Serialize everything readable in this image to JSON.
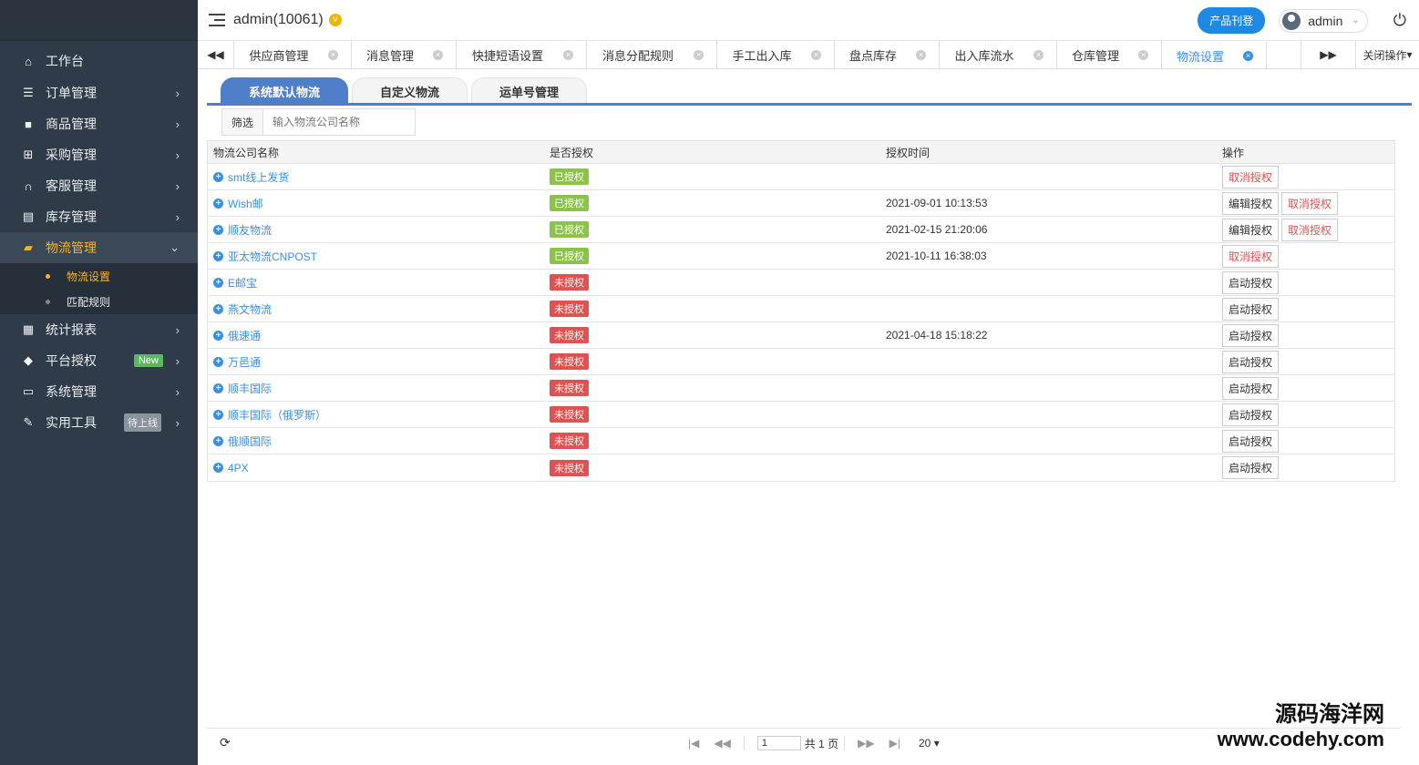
{
  "header": {
    "user_title": "admin(10061)",
    "vip_badge": "v",
    "product_button": "产品刊登",
    "user_name": "admin"
  },
  "sidebar": {
    "items": [
      {
        "label": "工作台",
        "icon": "home-icon"
      },
      {
        "label": "订单管理",
        "icon": "list-icon"
      },
      {
        "label": "商品管理",
        "icon": "box-icon"
      },
      {
        "label": "采购管理",
        "icon": "cart-icon"
      },
      {
        "label": "客服管理",
        "icon": "headset-icon"
      },
      {
        "label": "库存管理",
        "icon": "printer-icon"
      },
      {
        "label": "物流管理",
        "icon": "truck-icon"
      },
      {
        "label": "统计报表",
        "icon": "report-icon"
      },
      {
        "label": "平台授权",
        "icon": "shield-icon",
        "badge": "New"
      },
      {
        "label": "系统管理",
        "icon": "monitor-icon"
      },
      {
        "label": "实用工具",
        "icon": "wrench-icon",
        "badge": "待上线"
      }
    ],
    "logistics_sub": [
      "物流设置",
      "匹配规则"
    ]
  },
  "tabs": {
    "items": [
      "供应商管理",
      "消息管理",
      "快捷短语设置",
      "消息分配规则",
      "手工出入库",
      "盘点库存",
      "出入库流水",
      "仓库管理",
      "物流设置"
    ],
    "close_ops": "关闭操作"
  },
  "subtabs": [
    "系统默认物流",
    "自定义物流",
    "运单号管理"
  ],
  "filter": {
    "label": "筛选",
    "placeholder": "输入物流公司名称"
  },
  "table": {
    "headers": [
      "物流公司名称",
      "是否授权",
      "授权时间",
      "操作"
    ],
    "rows": [
      {
        "name": "smt线上发货",
        "status": "已授权",
        "time": "",
        "ops": [
          "取消授权"
        ]
      },
      {
        "name": "Wish邮",
        "status": "已授权",
        "time": "2021-09-01 10:13:53",
        "ops": [
          "编辑授权",
          "取消授权"
        ]
      },
      {
        "name": "顺友物流",
        "status": "已授权",
        "time": "2021-02-15 21:20:06",
        "ops": [
          "编辑授权",
          "取消授权"
        ]
      },
      {
        "name": "亚太物流CNPOST",
        "status": "已授权",
        "time": "2021-10-11 16:38:03",
        "ops": [
          "取消授权"
        ]
      },
      {
        "name": "E邮宝",
        "status": "未授权",
        "time": "",
        "ops": [
          "启动授权"
        ]
      },
      {
        "name": "燕文物流",
        "status": "未授权",
        "time": "",
        "ops": [
          "启动授权"
        ]
      },
      {
        "name": "俄速通",
        "status": "未授权",
        "time": "2021-04-18 15:18:22",
        "ops": [
          "启动授权"
        ]
      },
      {
        "name": "万邑通",
        "status": "未授权",
        "time": "",
        "ops": [
          "启动授权"
        ]
      },
      {
        "name": "顺丰国际",
        "status": "未授权",
        "time": "",
        "ops": [
          "启动授权"
        ]
      },
      {
        "name": "顺丰国际（俄罗斯）",
        "status": "未授权",
        "time": "",
        "ops": [
          "启动授权"
        ]
      },
      {
        "name": "俄顺国际",
        "status": "未授权",
        "time": "",
        "ops": [
          "启动授权"
        ]
      },
      {
        "name": "4PX",
        "status": "未授权",
        "time": "",
        "ops": [
          "启动授权"
        ]
      }
    ]
  },
  "pager": {
    "page_value": "1",
    "total_pages": "共 1 页",
    "page_size": "20"
  },
  "watermark": {
    "line1": "源码海洋网",
    "line2": "www.codehy.com"
  },
  "colors": {
    "sidebar_bg": "#2f3b48",
    "accent": "#3a8ee6",
    "active_menu": "#f6b22c",
    "authorized": "#8bc34a",
    "unauthorized": "#e05252"
  }
}
